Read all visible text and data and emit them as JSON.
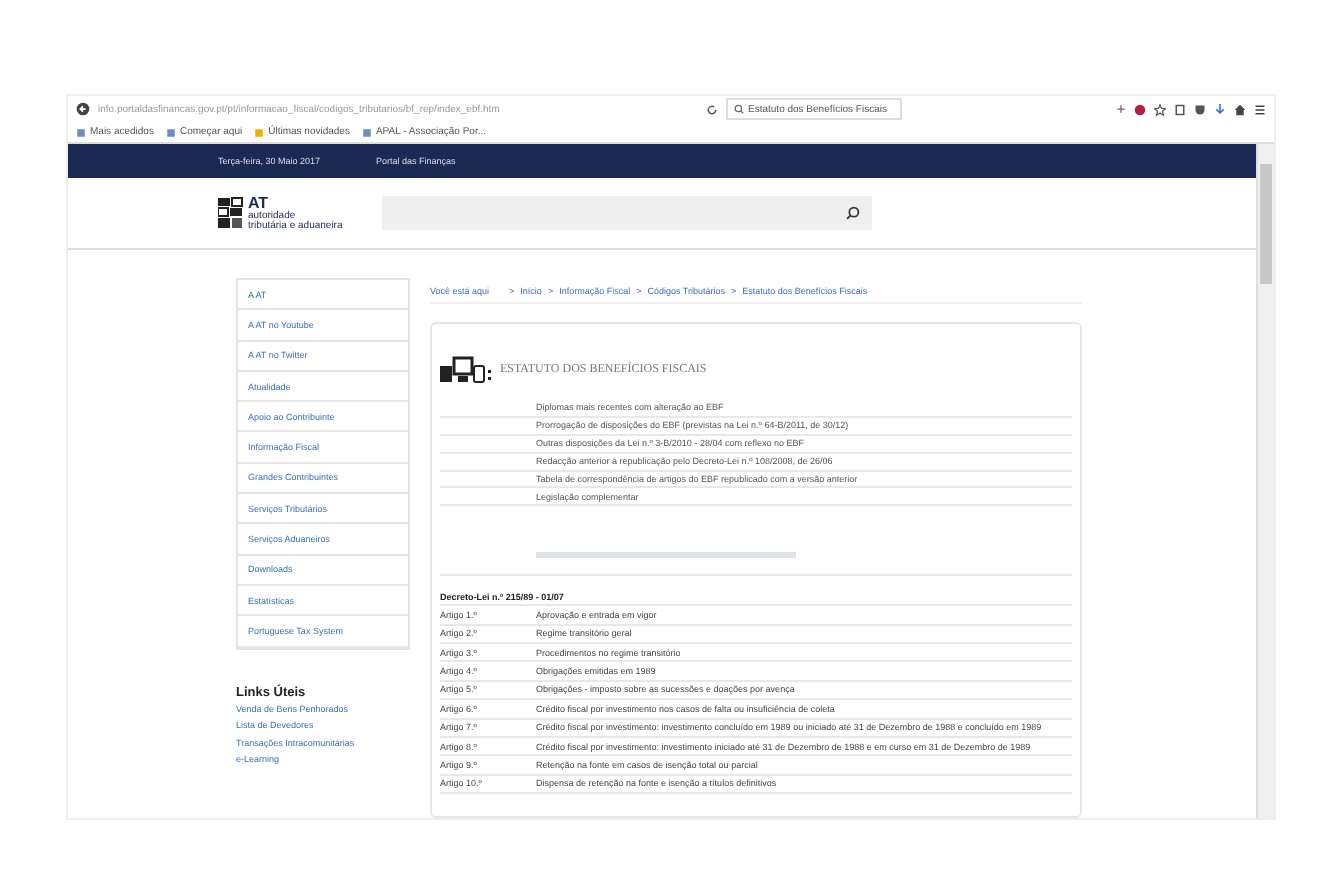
{
  "browser": {
    "url": "info.portaldasfinancas.gov.pt/pt/informacao_fiscal/codigos_tributarios/bf_rep/index_ebf.htm",
    "search": "Estatuto dos Benefícios Fiscais",
    "bookmarks": [
      "Mais acedidos",
      "Começar aqui",
      "Últimas novidades",
      "APAL - Associação Por..."
    ]
  },
  "topbar": {
    "date": "Terça-feira, 30 Maio 2017",
    "portal": "Portal das Finanças"
  },
  "logo": {
    "short": "AT",
    "line1": "autoridade",
    "line2": "tributária e aduaneira"
  },
  "sidebar": {
    "items": [
      "A AT",
      "A AT no Youtube",
      "A AT no Twitter",
      "Atualidade",
      "Apoio ao Contribuinte",
      "Informação Fiscal",
      "Grandes Contribuintes",
      "Serviços Tributários",
      "Serviços Aduaneiros",
      "Downloads",
      "Estatísticas",
      "Portuguese Tax System"
    ],
    "links_title": "Links Úteis",
    "links": [
      "Venda de Bens Penhorados",
      "Lista de Devedores",
      "Transações Intracomunitárias",
      "e-Learning"
    ]
  },
  "breadcrumb": {
    "label": "Você está aqui",
    "separator": ">",
    "items": [
      "Início",
      "Informação Fiscal",
      "Códigos Tributários",
      "Estatuto dos Benefícios Fiscais"
    ]
  },
  "panel": {
    "title": "ESTATUTO DOS BENEFÍCIOS FISCAIS",
    "links": [
      "Diplomas mais recentes com alteração ao EBF",
      "Prorrogação de disposições do EBF (previstas na Lei n.º 64-B/2011, de 30/12)",
      "Outras disposições da Lei n.º 3-B/2010 - 28/04 com reflexo no EBF",
      "Redacção anterior à republicação pelo Decreto-Lei n.º 108/2008, de 26/06",
      "Tabela de correspondência de artigos do EBF republicado com a versão anterior",
      "Legislação complementar"
    ],
    "decree_title": "Decreto-Lei n.º 215/89 - 01/07",
    "articles": [
      {
        "number": "Artigo 1.º",
        "title": "Aprovação e entrada em vigor"
      },
      {
        "number": "Artigo 2.º",
        "title": "Regime transitório geral"
      },
      {
        "number": "Artigo 3.º",
        "title": "Procedimentos no regime transitório"
      },
      {
        "number": "Artigo 4.º",
        "title": "Obrigações emitidas em 1989"
      },
      {
        "number": "Artigo 5.º",
        "title": "Obrigações - imposto sobre as sucessões e doações por avença"
      },
      {
        "number": "Artigo 6.º",
        "title": "Crédito fiscal por investimento nos casos de falta ou insuficiência de coleta"
      },
      {
        "number": "Artigo 7.º",
        "title": "Crédito fiscal por investimento: investimento concluído em 1989 ou iniciado até 31 de Dezembro de 1988 e concluído em 1989"
      },
      {
        "number": "Artigo 8.º",
        "title": "Crédito fiscal por investimento: investimento iniciado até 31 de Dezembro de 1988 e em curso em 31 de Dezembro de 1989"
      },
      {
        "number": "Artigo 9.º",
        "title": "Retenção na fonte em casos de isenção total ou parcial"
      },
      {
        "number": "Artigo 10.º",
        "title": "Dispensa de retenção na fonte e isenção a títulos definitivos"
      }
    ]
  }
}
